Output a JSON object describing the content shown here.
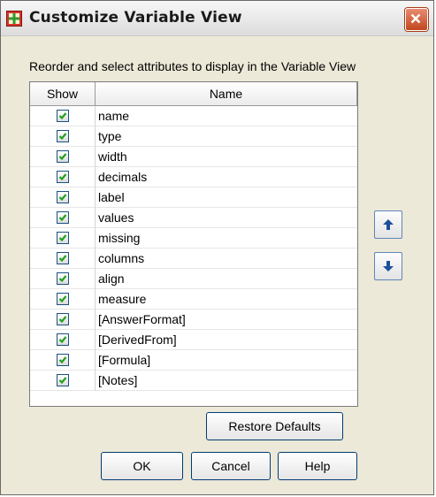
{
  "window": {
    "title": "Customize Variable View",
    "icon": "spss-dialog-icon",
    "close_icon": "close-icon"
  },
  "instruction": "Reorder and select attributes to display in the Variable View",
  "table": {
    "columns": [
      "Show",
      "Name"
    ],
    "rows": [
      {
        "name": "name",
        "checked": true
      },
      {
        "name": "type",
        "checked": true
      },
      {
        "name": "width",
        "checked": true
      },
      {
        "name": "decimals",
        "checked": true
      },
      {
        "name": "label",
        "checked": true
      },
      {
        "name": "values",
        "checked": true
      },
      {
        "name": "missing",
        "checked": true
      },
      {
        "name": "columns",
        "checked": true
      },
      {
        "name": "align",
        "checked": true
      },
      {
        "name": "measure",
        "checked": true
      },
      {
        "name": "[AnswerFormat]",
        "checked": true
      },
      {
        "name": "[DerivedFrom]",
        "checked": true
      },
      {
        "name": "[Formula]",
        "checked": true
      },
      {
        "name": "[Notes]",
        "checked": true
      }
    ]
  },
  "buttons": {
    "restore_defaults": "Restore Defaults",
    "ok": "OK",
    "cancel": "Cancel",
    "help": "Help"
  },
  "colors": {
    "check": "#21a121",
    "arrow": "#1e4f9c",
    "close": "#d2542b"
  }
}
